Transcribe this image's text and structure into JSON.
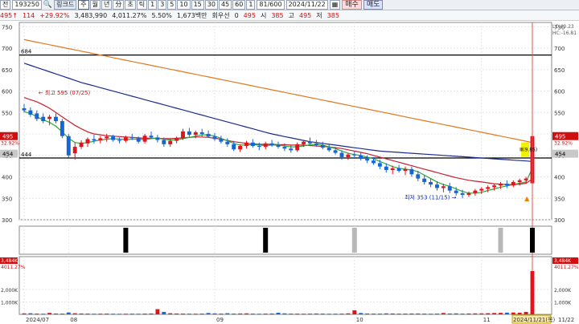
{
  "toolbar": {
    "market": "전",
    "code": "193250",
    "name": "링크드",
    "periods": [
      "주",
      "월",
      "년",
      "分",
      "초",
      "틱",
      "1",
      "3",
      "5",
      "10",
      "15",
      "30",
      "45",
      "60",
      "1"
    ],
    "count": "81/600",
    "date": "2024/11/22",
    "buy_label": "매수",
    "sell_label": "매도"
  },
  "info": {
    "price": "495",
    "change": "114",
    "change_pct": "+29.92%",
    "volume": "3,483,990",
    "volume_pct": "4,011.27%",
    "ratio": "5.50%",
    "amount": "1,673백만",
    "priority": "회우선",
    "qty": "0",
    "open_label": "시",
    "open": "385",
    "high_label": "고",
    "high": "495",
    "low_label": "저",
    "low": "385"
  },
  "chart_data": {
    "type": "candlestick",
    "price_axis": {
      "ylim": [
        300,
        760
      ],
      "ticks": [
        "750",
        "700",
        "650",
        "600",
        "550",
        "500",
        "450",
        "400",
        "350",
        "300"
      ]
    },
    "x_labels": [
      {
        "label": "2024/07",
        "index": 0
      },
      {
        "label": "08",
        "index": 7
      },
      {
        "label": "09",
        "index": 30
      },
      {
        "label": "10",
        "index": 52
      },
      {
        "label": "11",
        "index": 72
      },
      {
        "label": "2024/11/21(목)",
        "index": 80
      }
    ],
    "right_tag": "11/22",
    "candles": [
      [
        560,
        570,
        550,
        555
      ],
      [
        555,
        562,
        540,
        545
      ],
      [
        548,
        555,
        530,
        535
      ],
      [
        540,
        548,
        525,
        530
      ],
      [
        535,
        545,
        520,
        540
      ],
      [
        540,
        548,
        525,
        530
      ],
      [
        530,
        535,
        490,
        495
      ],
      [
        495,
        500,
        445,
        450
      ],
      [
        455,
        480,
        440,
        470
      ],
      [
        470,
        485,
        465,
        480
      ],
      [
        478,
        492,
        470,
        488
      ],
      [
        488,
        498,
        478,
        485
      ],
      [
        485,
        495,
        478,
        490
      ],
      [
        490,
        500,
        482,
        494
      ],
      [
        494,
        498,
        482,
        486
      ],
      [
        486,
        492,
        478,
        484
      ],
      [
        484,
        496,
        480,
        492
      ],
      [
        492,
        500,
        486,
        490
      ],
      [
        490,
        494,
        478,
        482
      ],
      [
        482,
        500,
        478,
        496
      ],
      [
        496,
        506,
        488,
        492
      ],
      [
        492,
        498,
        480,
        486
      ],
      [
        486,
        492,
        470,
        476
      ],
      [
        476,
        488,
        470,
        484
      ],
      [
        484,
        494,
        478,
        490
      ],
      [
        490,
        512,
        486,
        506
      ],
      [
        506,
        514,
        492,
        498
      ],
      [
        498,
        508,
        490,
        504
      ],
      [
        504,
        512,
        494,
        500
      ],
      [
        500,
        508,
        492,
        494
      ],
      [
        494,
        502,
        484,
        488
      ],
      [
        488,
        496,
        478,
        482
      ],
      [
        482,
        490,
        470,
        476
      ],
      [
        476,
        484,
        460,
        464
      ],
      [
        464,
        476,
        458,
        472
      ],
      [
        472,
        484,
        466,
        480
      ],
      [
        480,
        488,
        468,
        472
      ],
      [
        472,
        480,
        462,
        470
      ],
      [
        470,
        482,
        464,
        478
      ],
      [
        478,
        486,
        470,
        474
      ],
      [
        474,
        482,
        466,
        470
      ],
      [
        470,
        478,
        460,
        466
      ],
      [
        466,
        474,
        456,
        462
      ],
      [
        462,
        480,
        458,
        476
      ],
      [
        476,
        486,
        470,
        482
      ],
      [
        482,
        492,
        476,
        478
      ],
      [
        478,
        486,
        470,
        474
      ],
      [
        474,
        482,
        464,
        468
      ],
      [
        468,
        476,
        458,
        462
      ],
      [
        462,
        470,
        452,
        456
      ],
      [
        456,
        462,
        440,
        446
      ],
      [
        446,
        456,
        440,
        452
      ],
      [
        452,
        460,
        444,
        450
      ],
      [
        450,
        456,
        438,
        442
      ],
      [
        442,
        450,
        432,
        438
      ],
      [
        438,
        446,
        428,
        432
      ],
      [
        432,
        440,
        418,
        424
      ],
      [
        424,
        432,
        410,
        416
      ],
      [
        416,
        426,
        406,
        420
      ],
      [
        420,
        428,
        410,
        414
      ],
      [
        414,
        424,
        404,
        418
      ],
      [
        418,
        424,
        400,
        406
      ],
      [
        406,
        414,
        390,
        396
      ],
      [
        396,
        404,
        382,
        388
      ],
      [
        388,
        396,
        376,
        382
      ],
      [
        382,
        390,
        368,
        374
      ],
      [
        374,
        384,
        364,
        378
      ],
      [
        378,
        386,
        362,
        368
      ],
      [
        368,
        376,
        356,
        362
      ],
      [
        362,
        370,
        350,
        358
      ],
      [
        358,
        366,
        353,
        362
      ],
      [
        362,
        372,
        356,
        368
      ],
      [
        368,
        376,
        360,
        372
      ],
      [
        372,
        380,
        364,
        376
      ],
      [
        376,
        384,
        368,
        380
      ],
      [
        380,
        388,
        372,
        384
      ],
      [
        384,
        392,
        374,
        380
      ],
      [
        380,
        392,
        376,
        388
      ],
      [
        388,
        396,
        380,
        392
      ],
      [
        392,
        400,
        384,
        396
      ],
      [
        385,
        495,
        385,
        495
      ]
    ],
    "series": [
      {
        "color": "#e07a20",
        "values": [
          720,
          717,
          714,
          711,
          708,
          705,
          702,
          699,
          696,
          693,
          690,
          687,
          684,
          681,
          678,
          675,
          672,
          669,
          666,
          663,
          660,
          657,
          654,
          651,
          648,
          645,
          642,
          639,
          636,
          633,
          630,
          627,
          624,
          621,
          618,
          615,
          612,
          609,
          606,
          603,
          600,
          597,
          594,
          591,
          588,
          585,
          582,
          579,
          576,
          573,
          570,
          567,
          564,
          561,
          558,
          555,
          552,
          549,
          546,
          543,
          540,
          537,
          534,
          531,
          528,
          525,
          522,
          519,
          516,
          513,
          510,
          507,
          504,
          501,
          498,
          495,
          492,
          489,
          486,
          483,
          480
        ]
      },
      {
        "color": "#1c2a8c",
        "values": [
          665,
          660,
          655,
          650,
          645,
          640,
          635,
          630,
          625,
          620,
          616,
          612,
          608,
          604,
          600,
          596,
          592,
          588,
          584,
          580,
          576,
          572,
          568,
          564,
          560,
          556,
          552,
          548,
          544,
          540,
          536,
          532,
          528,
          524,
          520,
          516,
          512,
          508,
          504,
          500,
          497,
          494,
          491,
          488,
          485,
          482,
          480,
          478,
          476,
          474,
          472,
          470,
          468,
          466,
          464,
          462,
          460,
          459,
          458,
          457,
          456,
          455,
          454,
          453,
          452,
          451,
          450,
          449,
          448,
          447,
          446,
          445,
          444,
          443,
          442,
          441,
          440,
          439,
          438,
          437,
          436
        ]
      },
      {
        "color": "#c82030",
        "values": [
          585,
          580,
          575,
          568,
          560,
          550,
          540,
          530,
          520,
          512,
          505,
          500,
          498,
          496,
          495,
          494,
          493,
          492,
          491,
          490,
          490,
          490,
          489,
          489,
          490,
          491,
          492,
          493,
          493,
          492,
          490,
          488,
          485,
          482,
          480,
          478,
          477,
          476,
          476,
          476,
          475,
          475,
          474,
          474,
          474,
          473,
          472,
          471,
          470,
          468,
          466,
          463,
          460,
          457,
          454,
          450,
          446,
          442,
          438,
          434,
          430,
          426,
          422,
          418,
          414,
          410,
          406,
          402,
          398,
          395,
          392,
          390,
          388,
          386,
          384,
          383,
          382,
          382,
          383,
          385,
          395
        ]
      },
      {
        "color": "#2aa83a",
        "values": [
          552,
          548,
          540,
          533,
          527,
          518,
          505,
          490,
          480,
          478,
          480,
          483,
          486,
          488,
          489,
          488,
          487,
          488,
          488,
          487,
          489,
          490,
          488,
          486,
          486,
          489,
          492,
          495,
          498,
          498,
          495,
          490,
          484,
          478,
          474,
          474,
          475,
          474,
          473,
          474,
          474,
          472,
          470,
          470,
          472,
          475,
          476,
          474,
          470,
          466,
          460,
          455,
          452,
          450,
          446,
          442,
          436,
          430,
          424,
          420,
          418,
          416,
          412,
          404,
          396,
          388,
          382,
          378,
          372,
          366,
          362,
          362,
          364,
          368,
          372,
          376,
          379,
          382,
          385,
          388,
          420
        ]
      }
    ],
    "h_lines": [
      {
        "value": 684,
        "label": "684",
        "color": "#000000"
      },
      {
        "value": 444,
        "label": "444",
        "color": "#000000"
      }
    ],
    "price_tags": [
      {
        "value": 495,
        "label": "495",
        "bg": "#d01010",
        "fg": "#ffffff"
      },
      {
        "value": 454,
        "label": "454",
        "bg": "#c8c8c8",
        "fg": "#000000"
      }
    ],
    "right_tags": [
      {
        "value": 495,
        "label": "495",
        "bg": "#d01010",
        "fg": "#ffffff"
      },
      {
        "value": 454,
        "label": "454",
        "bg": "#c8c8c8",
        "fg": "#000000"
      }
    ],
    "left_pct": "32.92%",
    "right_pct": "32.92%",
    "top_right": [
      "LC:40.23",
      "HC:-16.81"
    ],
    "annotations": [
      {
        "text": "최고 595 (07/25)",
        "index": 2,
        "value": 595,
        "color": "#c01010"
      },
      {
        "text": "최저 353 (11/15)",
        "index": 69,
        "value": 353,
        "color": "#1030b0"
      },
      {
        "text": "Ⅲ(9.85)",
        "index": 79,
        "value": 454,
        "color": "#000000"
      }
    ],
    "signal_bars": [
      {
        "index": 16,
        "color": "#000000"
      },
      {
        "index": 38,
        "color": "#000000"
      },
      {
        "index": 52,
        "color": "#b8b8b8"
      },
      {
        "index": 75,
        "color": "#b8b8b8"
      },
      {
        "index": 80,
        "color": "#000000"
      }
    ],
    "volume": {
      "ticks": [
        "2,000K",
        "1,000K"
      ],
      "ylim": [
        0,
        4000
      ],
      "label_value": "3,484K",
      "label_pct": "4011.27%",
      "values": [
        80,
        90,
        60,
        50,
        120,
        70,
        60,
        150,
        90,
        70,
        60,
        50,
        55,
        60,
        50,
        45,
        50,
        55,
        50,
        60,
        70,
        420,
        200,
        90,
        70,
        60,
        55,
        50,
        60,
        110,
        80,
        60,
        90,
        60,
        70,
        80,
        60,
        50,
        60,
        70,
        130,
        80,
        60,
        55,
        50,
        60,
        70,
        60,
        50,
        55,
        60,
        80,
        330,
        110,
        70,
        60,
        60,
        80,
        70,
        60,
        60,
        70,
        70,
        60,
        50,
        60,
        110,
        70,
        80,
        60,
        70,
        80,
        80,
        90,
        110,
        120,
        140,
        150,
        130,
        200,
        3484
      ],
      "colors": [
        "r",
        "b",
        "r",
        "b",
        "r",
        "b",
        "b",
        "b",
        "r",
        "r",
        "r",
        "b",
        "r",
        "r",
        "b",
        "b",
        "r",
        "b",
        "b",
        "r",
        "r",
        "r",
        "b",
        "r",
        "r",
        "r",
        "b",
        "r",
        "b",
        "b",
        "b",
        "b",
        "b",
        "b",
        "r",
        "r",
        "b",
        "b",
        "r",
        "b",
        "b",
        "b",
        "b",
        "r",
        "r",
        "b",
        "b",
        "b",
        "b",
        "b",
        "b",
        "r",
        "r",
        "b",
        "b",
        "b",
        "b",
        "b",
        "r",
        "b",
        "r",
        "b",
        "b",
        "b",
        "b",
        "b",
        "r",
        "b",
        "b",
        "b",
        "r",
        "r",
        "r",
        "r",
        "r",
        "r",
        "b",
        "r",
        "r",
        "r",
        "r"
      ]
    }
  }
}
